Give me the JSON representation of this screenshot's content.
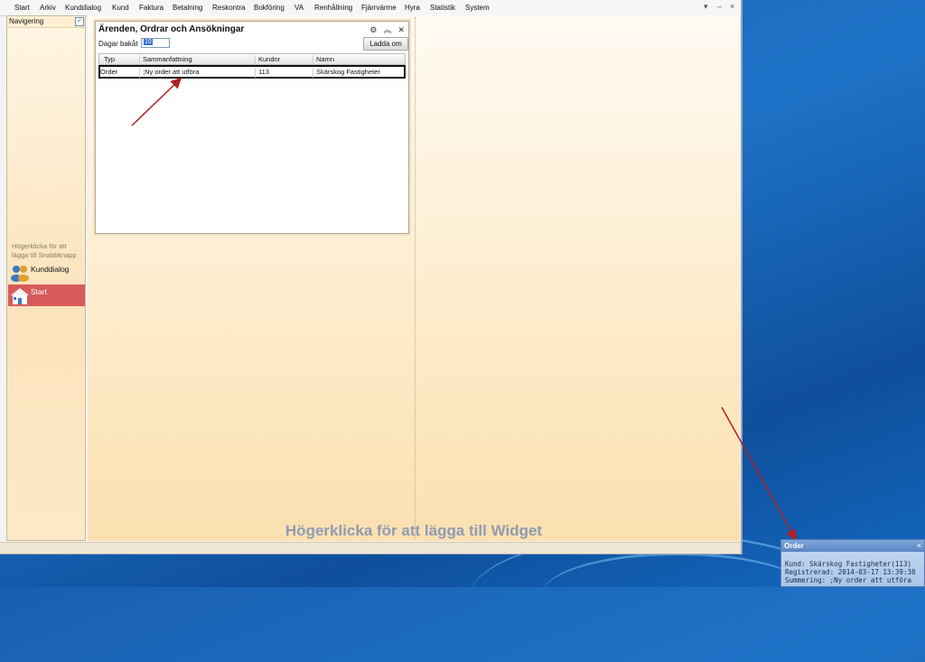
{
  "menu": [
    "Start",
    "Arkiv",
    "Kunddialog",
    "Kund",
    "Faktura",
    "Betalning",
    "Reskontra",
    "Bokföring",
    "VA",
    "Renhållning",
    "Fjärrvärme",
    "Hyra",
    "Statistik",
    "System"
  ],
  "window_controls": {
    "dropdown": "▾",
    "minimize": "–",
    "close": "×"
  },
  "sidebar": {
    "nav_label": "Navigering",
    "nav_checked": "✓",
    "hint": "Högerklicka för att lägga till Snabbknapp",
    "shortcuts": [
      {
        "label": "Kunddialog",
        "icon": "people-icon"
      },
      {
        "label": "Start",
        "icon": "house-icon"
      }
    ]
  },
  "panel": {
    "title": "Ärenden, Ordrar och Ansökningar",
    "days_label": "Dagar bakåt",
    "days_value": "10",
    "reload_label": "Ladda om",
    "columns": [
      "Typ",
      "Sammanfattning",
      "Kundnr",
      "Namn"
    ],
    "rows": [
      {
        "typ": "Order",
        "sammanfattning": ";Ny order att utföra",
        "kundnr": "113",
        "namn": "Skärskog Fastigheter"
      }
    ]
  },
  "widget_hint": "Högerklicka för att lägga till Widget",
  "notification": {
    "title": "Order",
    "lines": [
      "Kund: Skärskog Fastigheter(113)",
      "Registrerad: 2014-03-17 13:39:38",
      "Summering: ;Ny order att utföra"
    ]
  },
  "colors": {
    "accent_arrow": "#b02020",
    "start_shortcut": "#d75a5a",
    "desktop": "#1e73c8"
  }
}
